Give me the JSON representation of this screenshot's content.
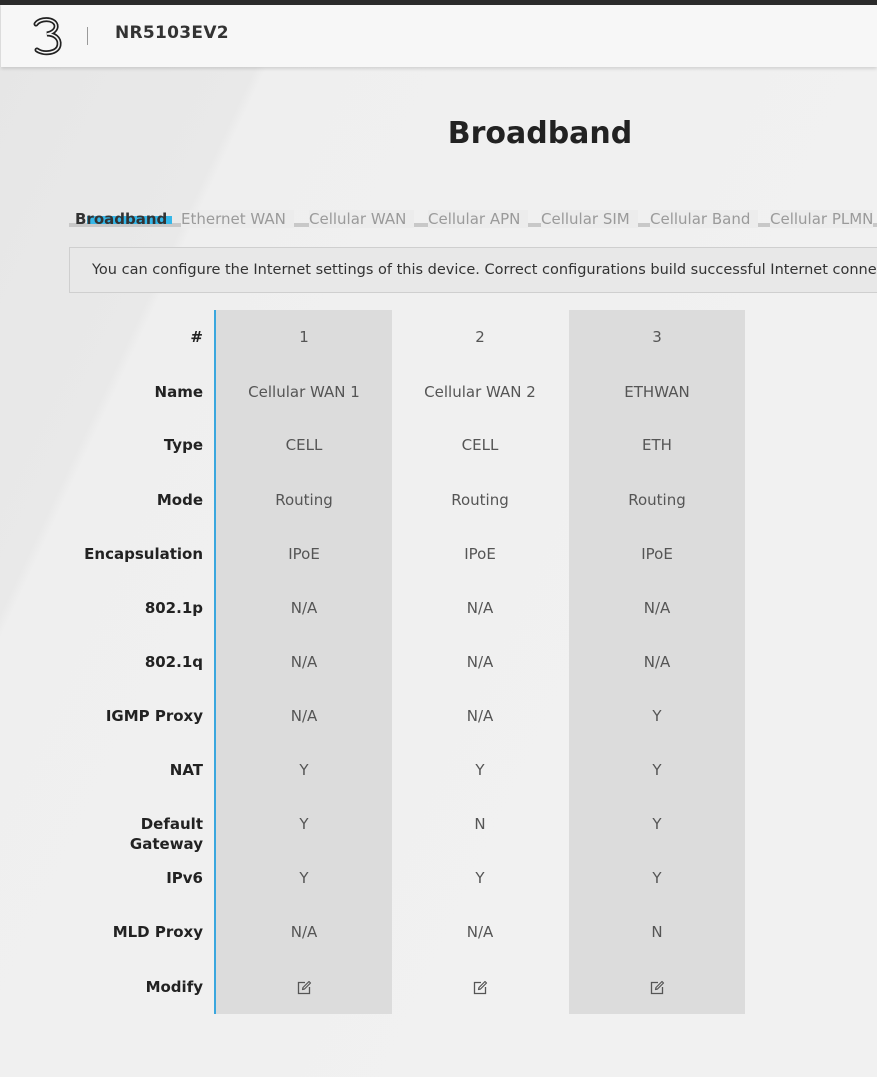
{
  "header": {
    "logo_icon": "three-logo-icon",
    "model": "NR5103EV2"
  },
  "page": {
    "title": "Broadband"
  },
  "tabs": [
    {
      "label": "Broadband",
      "active": true
    },
    {
      "label": "Ethernet WAN",
      "active": false
    },
    {
      "label": "Cellular WAN",
      "active": false
    },
    {
      "label": "Cellular APN",
      "active": false
    },
    {
      "label": "Cellular SIM",
      "active": false
    },
    {
      "label": "Cellular Band",
      "active": false
    },
    {
      "label": "Cellular PLMN",
      "active": false
    }
  ],
  "info_text": "You can configure the Internet settings of this device. Correct configurations build successful Internet connectio",
  "table": {
    "row_labels": [
      "#",
      "Name",
      "Type",
      "Mode",
      "Encapsulation",
      "802.1p",
      "802.1q",
      "IGMP Proxy",
      "NAT",
      "Default Gateway",
      "IPv6",
      "MLD Proxy",
      "Modify"
    ],
    "columns": [
      {
        "values": [
          "1",
          "Cellular WAN 1",
          "CELL",
          "Routing",
          "IPoE",
          "N/A",
          "N/A",
          "N/A",
          "Y",
          "Y",
          "Y",
          "N/A"
        ],
        "modify_icon": "edit-icon"
      },
      {
        "values": [
          "2",
          "Cellular WAN 2",
          "CELL",
          "Routing",
          "IPoE",
          "N/A",
          "N/A",
          "N/A",
          "Y",
          "N",
          "Y",
          "N/A"
        ],
        "modify_icon": "edit-icon"
      },
      {
        "values": [
          "3",
          "ETHWAN",
          "ETH",
          "Routing",
          "IPoE",
          "N/A",
          "N/A",
          "Y",
          "Y",
          "Y",
          "Y",
          "N"
        ],
        "modify_icon": "edit-icon"
      }
    ]
  },
  "colors": {
    "accent": "#35b7e8",
    "column_divider": "#3aa7de",
    "shaded_column": "#dcdcdc"
  }
}
